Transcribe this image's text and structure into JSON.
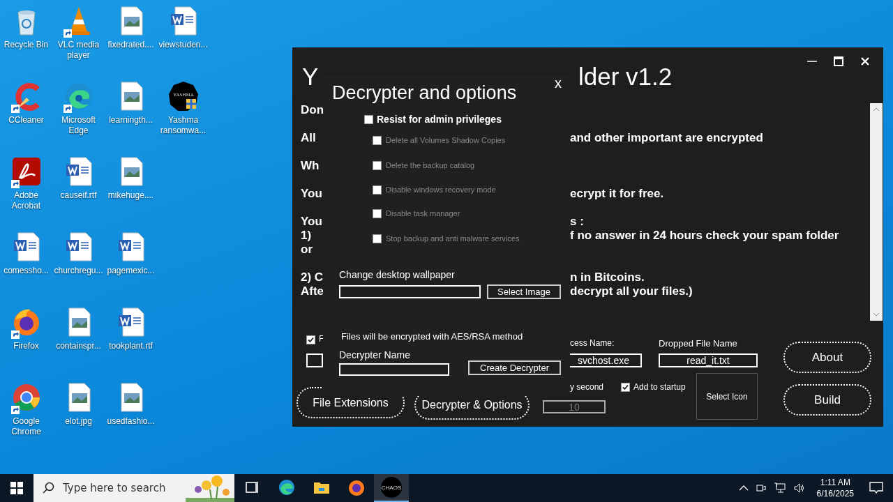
{
  "desktop_columns": [
    [
      {
        "label": "Recycle Bin",
        "kind": "recycle",
        "shortcut": false
      },
      {
        "label": "CCleaner",
        "kind": "ccleaner",
        "shortcut": true
      },
      {
        "label": "Adobe Acrobat",
        "kind": "acrobat",
        "shortcut": true
      },
      {
        "label": "comessho...",
        "kind": "word-file",
        "shortcut": false
      },
      {
        "label": "Firefox",
        "kind": "firefox",
        "shortcut": true
      },
      {
        "label": "Google Chrome",
        "kind": "chrome",
        "shortcut": true
      }
    ],
    [
      {
        "label": "VLC media player",
        "kind": "vlc",
        "shortcut": true
      },
      {
        "label": "Microsoft Edge",
        "kind": "edge",
        "shortcut": true
      },
      {
        "label": "causeif.rtf",
        "kind": "word-file",
        "shortcut": false
      },
      {
        "label": "churchregu...",
        "kind": "word-file",
        "shortcut": false
      },
      {
        "label": "containspr...",
        "kind": "image-file",
        "shortcut": false
      },
      {
        "label": "elot.jpg",
        "kind": "image-file",
        "shortcut": false
      }
    ],
    [
      {
        "label": "fixedrated....",
        "kind": "image-file",
        "shortcut": false
      },
      {
        "label": "learningth...",
        "kind": "image-file",
        "shortcut": false
      },
      {
        "label": "mikehuge....",
        "kind": "image-file",
        "shortcut": false
      },
      {
        "label": "pagemexic...",
        "kind": "word-file",
        "shortcut": false
      },
      {
        "label": "tookplant.rtf",
        "kind": "word-file",
        "shortcut": false
      },
      {
        "label": "usedfashio...",
        "kind": "image-file",
        "shortcut": false
      }
    ],
    [
      {
        "label": "viewstuden...",
        "kind": "word-file",
        "shortcut": false
      },
      {
        "label": "Yashma ransomwa...",
        "kind": "yashma",
        "shortcut": false,
        "logo_text": "YASHMA"
      }
    ]
  ],
  "main_window": {
    "title_left": "Y",
    "title_right": "lder v1.2",
    "paragraphs": [
      [
        {
          "left": "Don"
        }
      ],
      [
        {
          "left": "All",
          "right": "and other important are encrypted"
        }
      ],
      [
        {
          "left": "Wh"
        }
      ],
      [
        {
          "left": "You",
          "right": "ecrypt it for free."
        }
      ],
      [
        {
          "left": "You",
          "right": "s :"
        },
        {
          "left": "1)",
          "right": "f no answer in 24 hours check your spam folder"
        },
        {
          "left": "or"
        }
      ],
      [
        {
          "left": "2) C",
          "right": "n in Bitcoins."
        },
        {
          "left": "Afte",
          "right": "decrypt all your files.)"
        }
      ]
    ],
    "bottom": {
      "partial_checkbox": {
        "label": "F",
        "checked": true
      },
      "process_label": "cess Name:",
      "process_value": "svchost.exe",
      "dropped_label": "Dropped File Name",
      "dropped_value": "read_it.txt",
      "delay_label": "y second",
      "delay_value": "10",
      "startup": {
        "label": "Add to startup",
        "checked": true
      },
      "select_icon": "Select Icon",
      "buttons": [
        "File Extensions",
        "Decrypter & Options",
        "About",
        "Build"
      ]
    }
  },
  "dialog": {
    "title": "Decrypter and options",
    "close": "x",
    "main_option": {
      "label": "Resist for admin privileges",
      "checked": false
    },
    "options": [
      {
        "label": "Delete all Volumes Shadow Copies",
        "checked": false,
        "disabled": true
      },
      {
        "label": "Delete the backup catalog",
        "checked": false,
        "disabled": true
      },
      {
        "label": "Disable windows recovery mode",
        "checked": false,
        "disabled": true
      },
      {
        "label": "Disable task manager",
        "checked": false,
        "disabled": true
      },
      {
        "label": "Stop backup and anti malware services",
        "checked": false,
        "disabled": true
      }
    ],
    "wallpaper_label": "Change desktop wallpaper",
    "select_image": "Select Image",
    "method_text": "Files will be encrypted with AES/RSA method",
    "decrypter_label": "Decrypter Name",
    "create_button": "Create Decrypter"
  },
  "taskbar": {
    "search_placeholder": "Type here to search",
    "apps": [
      {
        "kind": "taskview",
        "selected": false
      },
      {
        "kind": "edge",
        "selected": false
      },
      {
        "kind": "explorer",
        "selected": false
      },
      {
        "kind": "firefox",
        "selected": false
      },
      {
        "kind": "chaos",
        "selected": true,
        "logo_text": "CHAOS"
      }
    ],
    "time": "1:11 AM",
    "date": "6/16/2025"
  }
}
